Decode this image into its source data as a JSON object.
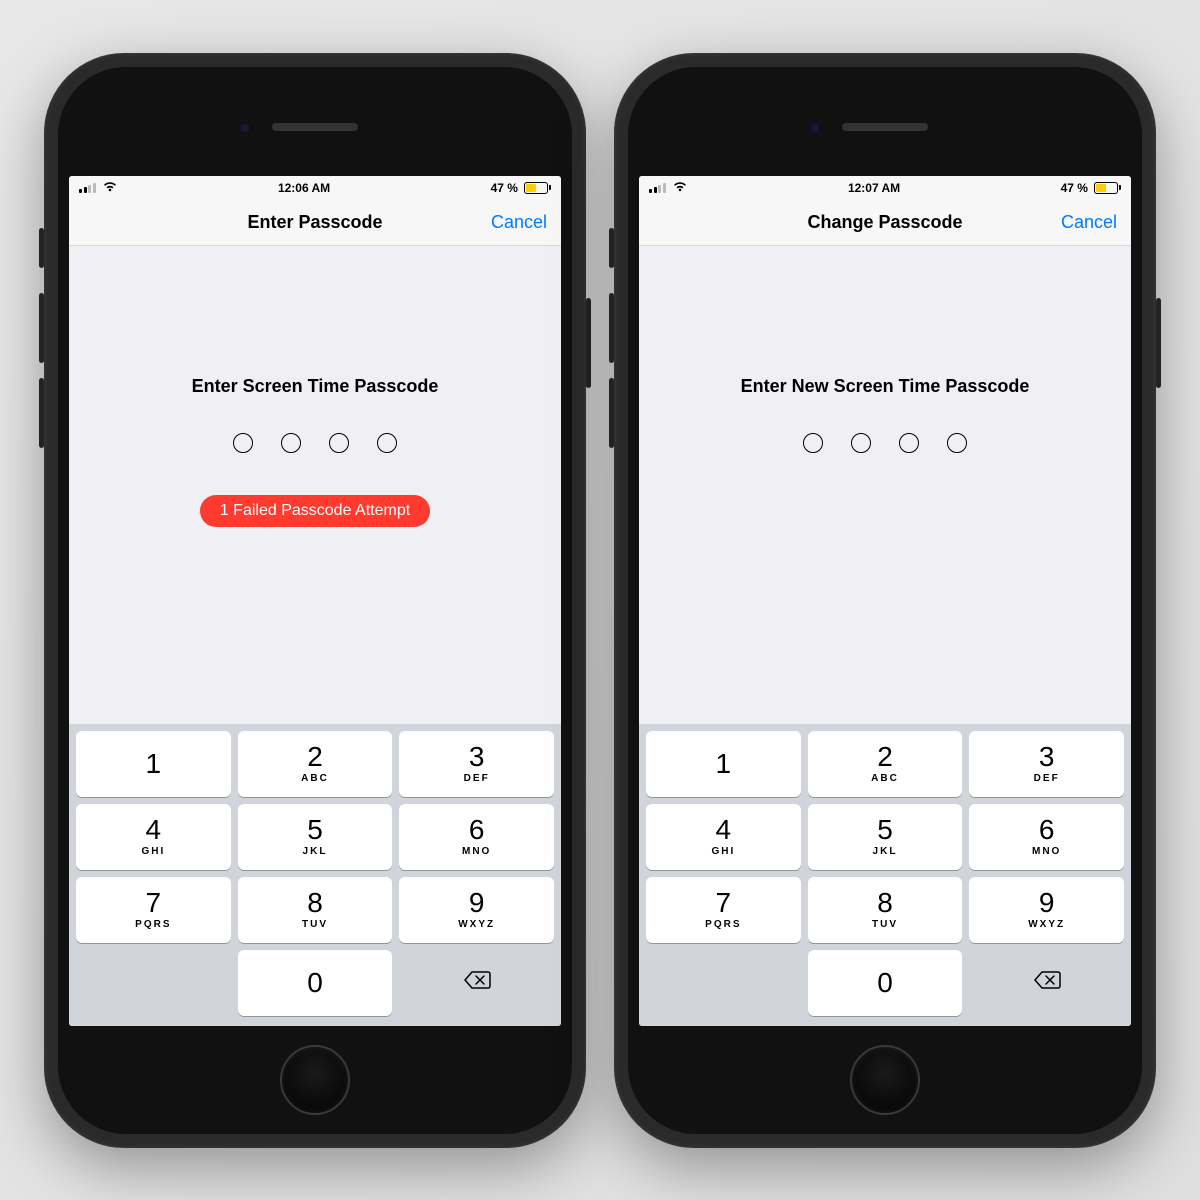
{
  "phones": [
    {
      "status": {
        "time": "12:06 AM",
        "battery_pct": "47 %"
      },
      "nav": {
        "title": "Enter Passcode",
        "cancel": "Cancel"
      },
      "content": {
        "prompt": "Enter Screen Time Passcode",
        "error": "1 Failed Passcode Attempt",
        "show_error": true
      }
    },
    {
      "status": {
        "time": "12:07 AM",
        "battery_pct": "47 %"
      },
      "nav": {
        "title": "Change Passcode",
        "cancel": "Cancel"
      },
      "content": {
        "prompt": "Enter New Screen Time Passcode",
        "error": "",
        "show_error": false
      }
    }
  ],
  "keypad": {
    "rows": [
      [
        {
          "n": "1",
          "l": ""
        },
        {
          "n": "2",
          "l": "ABC"
        },
        {
          "n": "3",
          "l": "DEF"
        }
      ],
      [
        {
          "n": "4",
          "l": "GHI"
        },
        {
          "n": "5",
          "l": "JKL"
        },
        {
          "n": "6",
          "l": "MNO"
        }
      ],
      [
        {
          "n": "7",
          "l": "PQRS"
        },
        {
          "n": "8",
          "l": "TUV"
        },
        {
          "n": "9",
          "l": "WXYZ"
        }
      ],
      [
        {
          "blank": true
        },
        {
          "n": "0",
          "l": ""
        },
        {
          "del": true
        }
      ]
    ]
  }
}
